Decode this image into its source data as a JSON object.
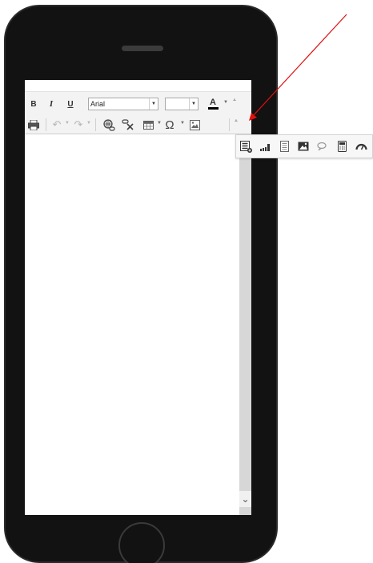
{
  "toolbar": {
    "bold_label": "B",
    "italic_label": "I",
    "underline_label": "U",
    "font_family_value": "Arial",
    "font_size_value": "",
    "font_color_label": "A",
    "font_color": "#000000",
    "omega_label": "Ω",
    "more_label": "⩡"
  },
  "scroll": {
    "down_label": "⌄"
  },
  "overflow_popup": {
    "items": [
      {
        "icon": "insert-list-icon"
      },
      {
        "icon": "signal-bars-icon"
      },
      {
        "icon": "document-icon"
      },
      {
        "icon": "image-icon"
      },
      {
        "icon": "link-icon"
      },
      {
        "icon": "calculator-icon"
      },
      {
        "icon": "gauge-icon"
      }
    ]
  },
  "colors": {
    "phone_body": "#121212",
    "toolbar_bg": "#f3f3f3",
    "annotation_arrow": "#e01010"
  }
}
